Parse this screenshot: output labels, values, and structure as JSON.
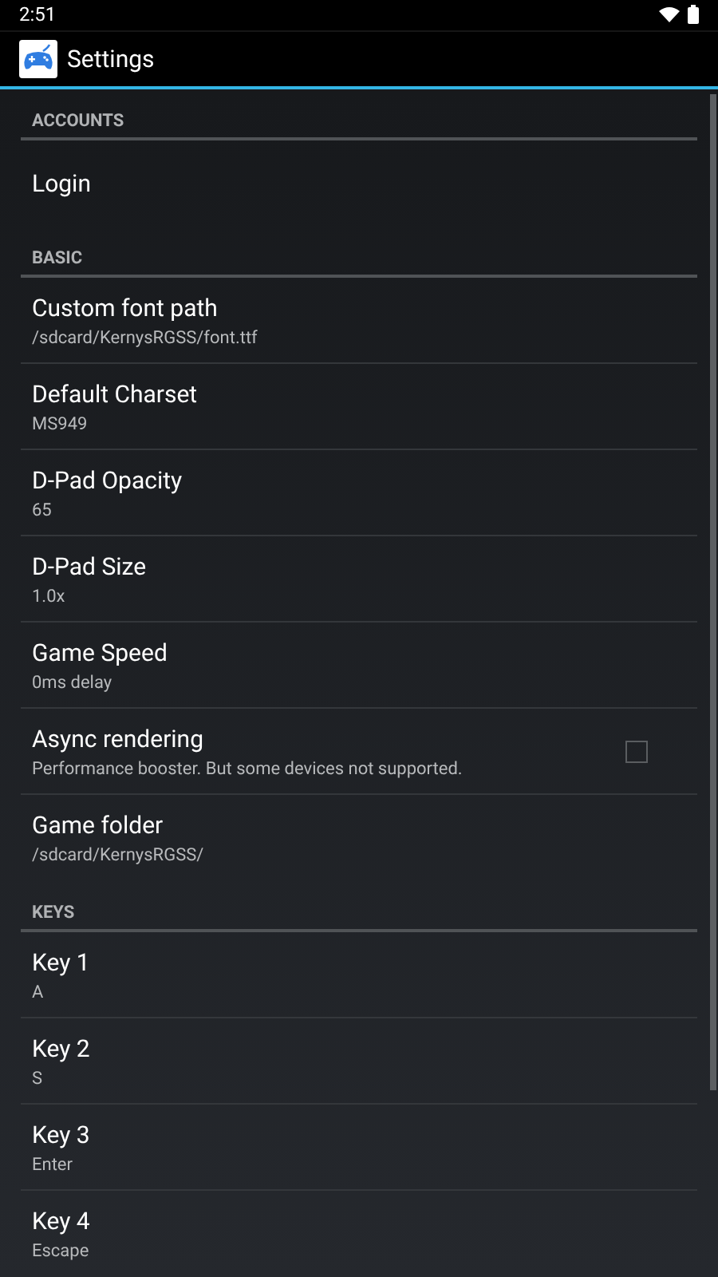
{
  "status_bar": {
    "time": "2:51"
  },
  "action_bar": {
    "title": "Settings"
  },
  "sections": [
    {
      "header": "ACCOUNTS",
      "items": [
        {
          "kind": "text",
          "title": "Login"
        }
      ]
    },
    {
      "header": "BASIC",
      "items": [
        {
          "kind": "text",
          "title": "Custom font path",
          "summary": "/sdcard/KernysRGSS/font.ttf"
        },
        {
          "kind": "text",
          "title": "Default Charset",
          "summary": "MS949"
        },
        {
          "kind": "text",
          "title": "D-Pad Opacity",
          "summary": "65"
        },
        {
          "kind": "text",
          "title": "D-Pad Size",
          "summary": "1.0x"
        },
        {
          "kind": "text",
          "title": "Game Speed",
          "summary": "0ms delay"
        },
        {
          "kind": "checkbox",
          "title": "Async rendering",
          "summary": "Performance booster. But some devices not supported.",
          "checked": false
        },
        {
          "kind": "text",
          "title": "Game folder",
          "summary": "/sdcard/KernysRGSS/"
        }
      ]
    },
    {
      "header": "KEYS",
      "items": [
        {
          "kind": "text",
          "title": "Key 1",
          "summary": "A"
        },
        {
          "kind": "text",
          "title": "Key 2",
          "summary": "S"
        },
        {
          "kind": "text",
          "title": "Key 3",
          "summary": "Enter"
        },
        {
          "kind": "text",
          "title": "Key 4",
          "summary": "Escape"
        }
      ]
    }
  ]
}
